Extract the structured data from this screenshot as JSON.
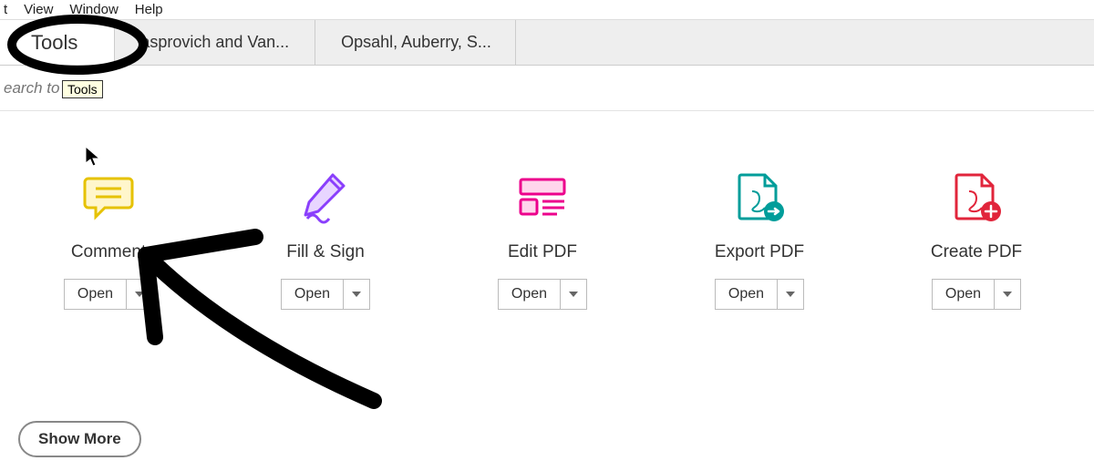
{
  "menu": {
    "items": [
      "t",
      "View",
      "Window",
      "Help"
    ]
  },
  "tabs": {
    "tools": "Tools",
    "docs": [
      "asprovich and Van...",
      "Opsahl, Auberry, S..."
    ]
  },
  "search": {
    "placeholder": "earch to"
  },
  "tooltip": "Tools",
  "tools": [
    {
      "name": "Comment",
      "open": "Open"
    },
    {
      "name": "Fill & Sign",
      "open": "Open"
    },
    {
      "name": "Edit PDF",
      "open": "Open"
    },
    {
      "name": "Export PDF",
      "open": "Open"
    },
    {
      "name": "Create PDF",
      "open": "Open"
    }
  ],
  "showmore": "Show More"
}
